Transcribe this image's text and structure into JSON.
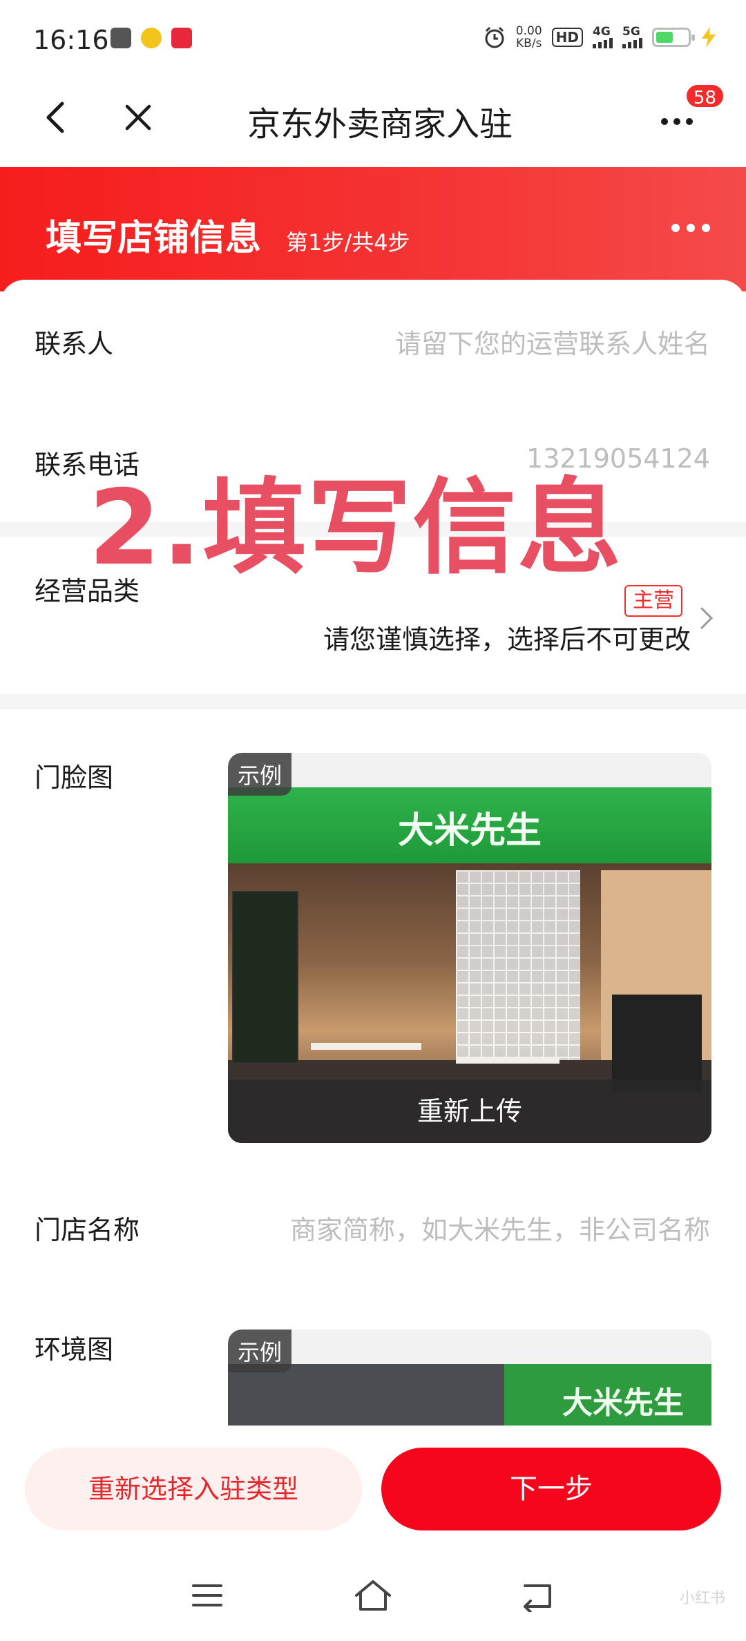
{
  "status_bar": {
    "time": "16:16",
    "net_speed_value": "0.00",
    "net_speed_unit": "KB/s",
    "hd": "HD",
    "sim1": "4G",
    "sim2": "5G"
  },
  "nav": {
    "title": "京东外卖商家入驻",
    "badge_count": "58"
  },
  "header": {
    "title": "填写店铺信息",
    "step": "第1步/共4步"
  },
  "overlay_text": "2.填写信息",
  "form": {
    "contact": {
      "label": "联系人",
      "placeholder": "请留下您的运营联系人姓名"
    },
    "phone": {
      "label": "联系电话",
      "value": "13219054124"
    },
    "category": {
      "label": "经营品类",
      "tag": "主营",
      "hint": "请您谨慎选择，选择后不可更改"
    },
    "storefront": {
      "label": "门脸图",
      "example_tag": "示例",
      "reupload": "重新上传",
      "sign_text": "大米先生"
    },
    "store_name": {
      "label": "门店名称",
      "placeholder": "商家简称，如大米先生，非公司名称"
    },
    "environment": {
      "label": "环境图",
      "example_tag": "示例",
      "sign_text": "大米先生"
    }
  },
  "actions": {
    "reselect": "重新选择入驻类型",
    "next": "下一步"
  },
  "system_nav": {
    "watermark": "小红书"
  },
  "colors": {
    "brand_red": "#f5061d",
    "header_red": "#f61d1d",
    "placeholder_gray": "#bdbdbd",
    "overlay_pink": "#e7465a"
  }
}
